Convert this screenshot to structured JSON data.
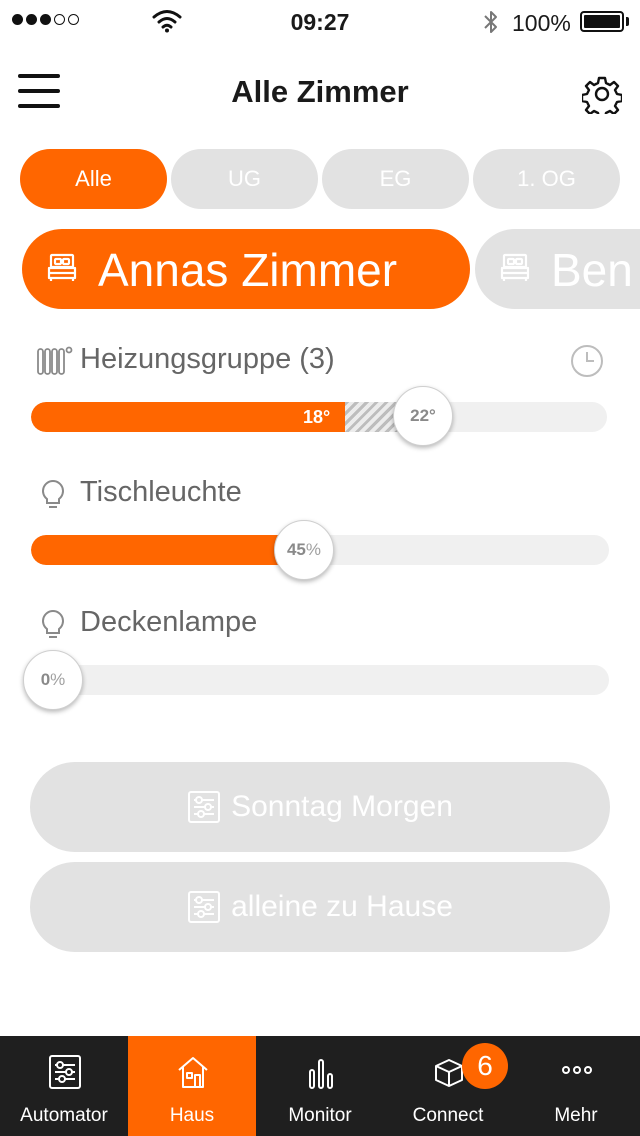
{
  "status_bar": {
    "time": "09:27",
    "battery": "100%"
  },
  "header": {
    "title": "Alle Zimmer"
  },
  "floor_tabs": [
    {
      "label": "Alle",
      "active": true
    },
    {
      "label": "UG",
      "active": false
    },
    {
      "label": "EG",
      "active": false
    },
    {
      "label": "1. OG",
      "active": false
    }
  ],
  "rooms": [
    {
      "label": "Annas Zimmer",
      "active": true
    },
    {
      "label": "Ben",
      "active": false
    }
  ],
  "devices": {
    "heating": {
      "name": "Heizungsgruppe (3)",
      "current_label": "18°",
      "target_label": "22°",
      "current_fraction": 0.545,
      "target_fraction": 0.68
    },
    "lamp1": {
      "name": "Tischleuchte",
      "value": "45",
      "unit": "%",
      "level": 45
    },
    "lamp2": {
      "name": "Deckenlampe",
      "value": "0",
      "unit": "%",
      "level": 0
    }
  },
  "scenes": [
    {
      "label": "Sonntag Morgen"
    },
    {
      "label": "alleine zu Hause"
    }
  ],
  "tab_bar": {
    "items": [
      {
        "label": "Automator",
        "icon": "sliders-icon",
        "active": false
      },
      {
        "label": "Haus",
        "icon": "house-icon",
        "active": true
      },
      {
        "label": "Monitor",
        "icon": "bar-chart-icon",
        "active": false
      },
      {
        "label": "Connect",
        "icon": "cube-icon",
        "active": false
      },
      {
        "label": "Mehr",
        "icon": "more-dots-icon",
        "active": false
      }
    ],
    "badge": "6"
  },
  "colors": {
    "accent": "#ff6600",
    "inactive": "#e2e2e2",
    "tabbar": "#1f1f1f"
  }
}
